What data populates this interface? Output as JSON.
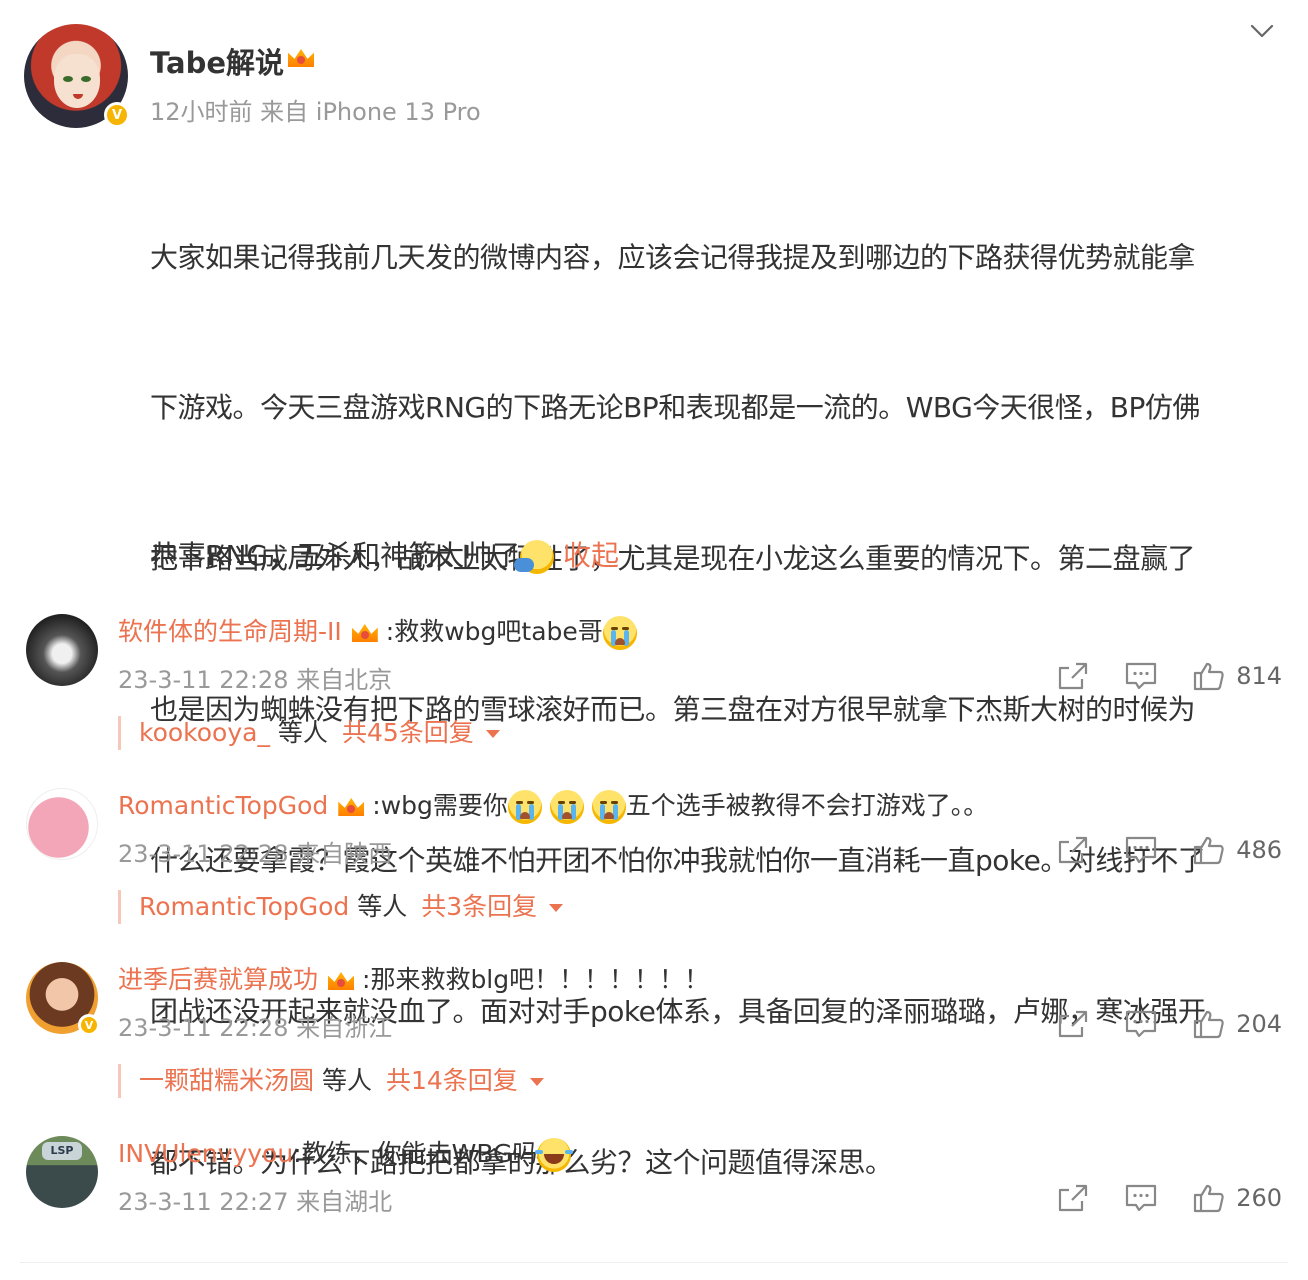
{
  "post": {
    "author": "Tabe解说",
    "meta": "12小时前  来自 iPhone 13 Pro",
    "body_lines": [
      "大家如果记得我前几天发的微博内容，应该会记得我提及到哪边的下路获得优势就能拿",
      "下游戏。今天三盘游戏RNG的下路无论BP和表现都是一流的。WBG今天很怪，BP仿佛",
      "把下路当成局外人，战术上太牺牲了，尤其是现在小龙这么重要的情况下。第二盘赢了",
      "也是因为蜘蛛没有把下路的雪球滚好而已。第三盘在对方很早就拿下杰斯大树的时候为",
      "什么还要拿霞？霞这个英雄不怕开团不怕你冲我就怕你一直消耗一直poke。对线打不了",
      "团战还没开起来就没血了。面对对手poke体系，具备回复的泽丽璐璐，卢娜，寒冰强开",
      "都不错。为什么下路把把都拿的那么劣？这个问题值得深思。"
    ],
    "last_line": "恭喜RNG，五杀和神箭太帅了",
    "collapse_label": "收起",
    "verified_mark": "V"
  },
  "comments": [
    {
      "user": "软件体的生命周期-II",
      "text_before": ":救救wbg吧tabe哥",
      "text_after": "",
      "meta": "23-3-11 22:28 来自北京",
      "likes": "814",
      "reply_user": "kookooya_",
      "reply_suffix": " 等人",
      "reply_count": "共45条回复"
    },
    {
      "user": "RomanticTopGod",
      "text_before": ":wbg需要你",
      "text_after": "五个选手被教得不会打游戏了。。",
      "meta": "23-3-11 22:28 来自陕西",
      "likes": "486",
      "reply_user": "RomanticTopGod",
      "reply_suffix": " 等人",
      "reply_count": "共3条回复"
    },
    {
      "user": "进季后赛就算成功",
      "text_before": ":那来救救blg吧！！！！！！！",
      "text_after": "",
      "meta": "23-3-11 22:28 来自浙江",
      "likes": "204",
      "reply_user": "一颗甜糯米汤圆",
      "reply_suffix": " 等人",
      "reply_count": "共14条回复",
      "verified_mark": "V"
    },
    {
      "user": "INVUlenvyyou",
      "text_before": ":教练，你能去WBG吗",
      "text_after": "",
      "meta": "23-3-11 22:27 来自湖北",
      "likes": "260",
      "avatar_text": "LSP"
    }
  ],
  "colors": {
    "accent": "#eb7350",
    "meta_gray": "#999999",
    "text": "#333333",
    "badge": "#f7b500"
  },
  "icons": [
    "chevron-down-icon",
    "crown-icon",
    "share-icon",
    "comment-icon",
    "like-icon",
    "cry-emoji-icon",
    "laugh-emoji-icon",
    "wave-emoji-icon"
  ]
}
